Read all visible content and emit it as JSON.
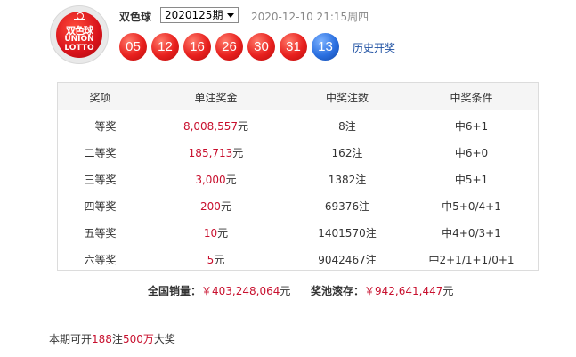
{
  "logo": {
    "cn": "双色球",
    "en1": "UNION",
    "en2": "LOTTO"
  },
  "header": {
    "title": "双色球",
    "issue": "2020125期",
    "draw_time": "2020-12-10 21:15周四",
    "history_link": "历史开奖"
  },
  "balls": {
    "red": [
      "05",
      "12",
      "16",
      "26",
      "30",
      "31"
    ],
    "blue": "13"
  },
  "table": {
    "headers": [
      "奖项",
      "单注奖金",
      "中奖注数",
      "中奖条件"
    ],
    "rows": [
      {
        "level": "一等奖",
        "prize": "8,008,557",
        "unit": "元",
        "count": "8注",
        "cond": "中6+1"
      },
      {
        "level": "二等奖",
        "prize": "185,713",
        "unit": "元",
        "count": "162注",
        "cond": "中6+0"
      },
      {
        "level": "三等奖",
        "prize": "3,000",
        "unit": "元",
        "count": "1382注",
        "cond": "中5+1"
      },
      {
        "level": "四等奖",
        "prize": "200",
        "unit": "元",
        "count": "69376注",
        "cond": "中5+0/4+1"
      },
      {
        "level": "五等奖",
        "prize": "10",
        "unit": "元",
        "count": "1401570注",
        "cond": "中4+0/3+1"
      },
      {
        "level": "六等奖",
        "prize": "5",
        "unit": "元",
        "count": "9042467注",
        "cond": "中2+1/1+1/0+1"
      }
    ]
  },
  "summary": {
    "sales_label": "全国销量：",
    "sales_value": "￥403,248,064",
    "sales_unit": "元",
    "pool_label": "奖池滚存：",
    "pool_value": "￥942,641,447",
    "pool_unit": "元"
  },
  "note": {
    "prefix": "本期可开",
    "count": "188",
    "mid": "注",
    "amount": "500万",
    "suffix": "大奖"
  },
  "colors": {
    "accent_red": "#c8102e",
    "link_blue": "#1e50a2",
    "ball_red": "#e8201e",
    "ball_blue": "#2a6fe0"
  }
}
